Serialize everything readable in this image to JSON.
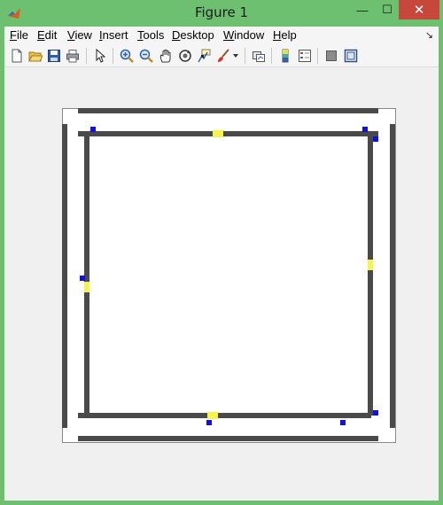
{
  "window": {
    "title": "Figure 1",
    "controls": {
      "minimize": "—",
      "maximize": "☐",
      "close": "✕"
    }
  },
  "menubar": {
    "items": [
      {
        "label": "File",
        "accel": "F"
      },
      {
        "label": "Edit",
        "accel": "E"
      },
      {
        "label": "View",
        "accel": "V"
      },
      {
        "label": "Insert",
        "accel": "I"
      },
      {
        "label": "Tools",
        "accel": "T"
      },
      {
        "label": "Desktop",
        "accel": "D"
      },
      {
        "label": "Window",
        "accel": "W"
      },
      {
        "label": "Help",
        "accel": "H"
      }
    ],
    "dock_arrow": "↘"
  },
  "toolbar": {
    "buttons": [
      "new-figure-icon",
      "open-file-icon",
      "save-icon",
      "print-icon",
      "edit-plot-icon",
      "zoom-in-icon",
      "zoom-out-icon",
      "pan-icon",
      "rotate-3d-icon",
      "data-cursor-icon",
      "brush-icon",
      "link-plot-icon",
      "insert-colorbar-icon",
      "insert-legend-icon",
      "hide-plot-tools-icon",
      "show-plot-tools-icon"
    ]
  },
  "colors": {
    "frame": "#6cc070",
    "wall": "#4a4a4a",
    "blue_marker": "#1010e0",
    "yellow_marker": "#f4f44a"
  }
}
